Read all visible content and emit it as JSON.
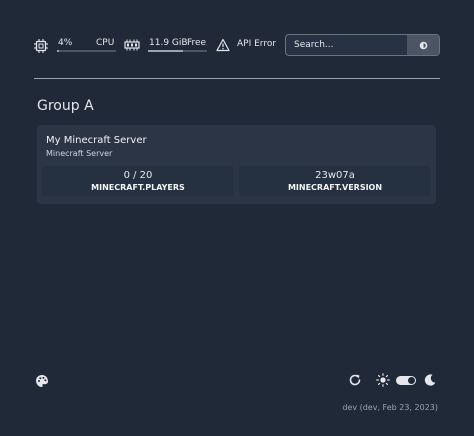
{
  "widgets": {
    "cpu": {
      "value": "4%",
      "label": "CPU",
      "percent": 4
    },
    "memory": {
      "value": "11.9 GiB",
      "label": "Free",
      "percent": 60
    },
    "api": {
      "label": "API Error"
    }
  },
  "search": {
    "placeholder": "Search..."
  },
  "groups": [
    {
      "title": "Group A",
      "services": [
        {
          "name": "My Minecraft Server",
          "description": "Minecraft Server",
          "stats": [
            {
              "value": "0 / 20",
              "label": "MINECRAFT.PLAYERS"
            },
            {
              "value": "23w07a",
              "label": "MINECRAFT.VERSION"
            }
          ]
        }
      ]
    }
  ],
  "footer": {
    "version": "dev (dev, Feb 23, 2023)",
    "icons": [
      "palette-icon",
      "refresh-icon",
      "sun-icon",
      "theme-toggle",
      "moon-icon"
    ]
  },
  "colors": {
    "background": "#1f2937",
    "card": "#2b3545",
    "stat": "#253041",
    "text": "#e5e7eb"
  }
}
